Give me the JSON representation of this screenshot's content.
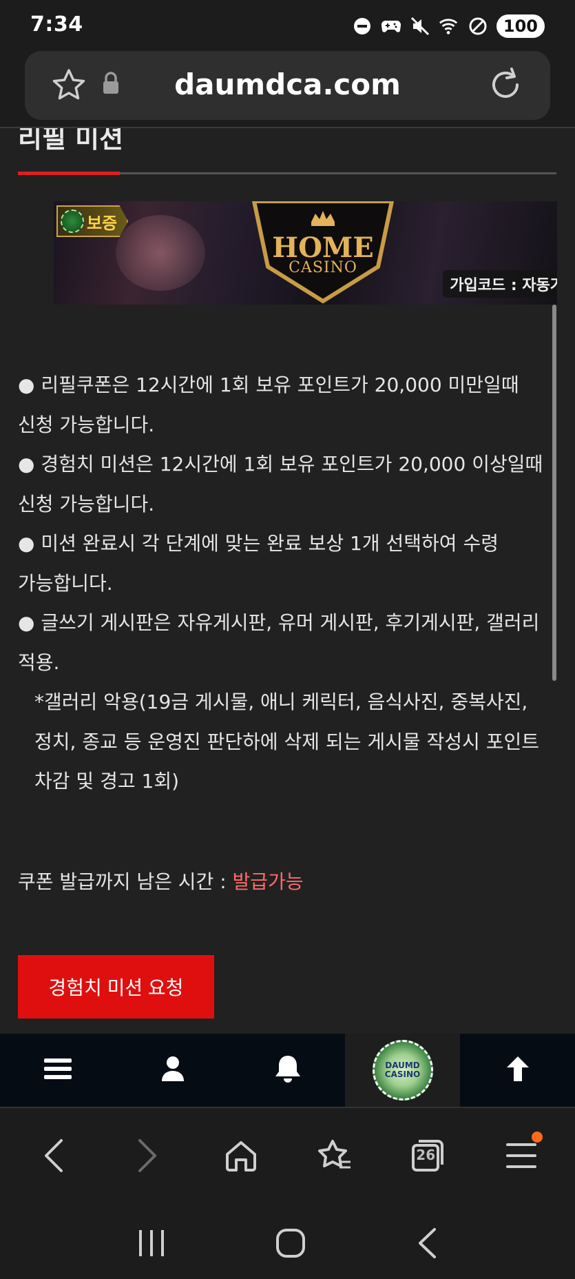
{
  "status_bar": {
    "time": "7:34",
    "battery": "100",
    "icons": [
      "do-not-disturb-icon",
      "game-controller-icon",
      "mute-icon",
      "wifi-icon",
      "blocked-icon"
    ]
  },
  "browser": {
    "url": "daumdca.com",
    "tab_count": "26",
    "icons": [
      "bookmark-star-icon",
      "lock-icon",
      "reload-icon",
      "back-icon",
      "forward-icon",
      "home-icon",
      "bookmarks-icon",
      "tabs-icon",
      "menu-icon"
    ]
  },
  "page": {
    "title": "리필 미션",
    "banner": {
      "badge": "보증",
      "brand_line1": "HOME",
      "brand_line2": "CASINO",
      "code_label": "가입코드 : 자동가"
    },
    "rules": [
      "● 리필쿠폰은 12시간에 1회 보유 포인트가 20,000 미만일때 신청 가능합니다.",
      "● 경험치 미션은 12시간에 1회 보유 포인트가 20,000 이상일때 신청 가능합니다.",
      "● 미션 완료시 각 단계에 맞는 완료 보상 1개 선택하여 수령 가능합니다.",
      "● 글쓰기 게시판은 자유게시판, 유머 게시판, 후기게시판, 갤러리 적용.",
      "*갤러리 악용(19금 게시물, 애니 케릭터, 음식사진, 중복사진, 정치, 종교 등 운영진 판단하에 삭제 되는 게시물 작성시 포인트 차감 및 경고 1회)"
    ],
    "coupon_label": "쿠폰 발급까지 남은 시간 : ",
    "coupon_status": "발급가능",
    "mission_button": "경험치 미션 요청"
  },
  "site_nav": {
    "items": [
      "menu-icon",
      "user-icon",
      "bell-icon",
      "daum-casino-logo",
      "arrow-up-icon"
    ],
    "logo_line1": "DAUMD",
    "logo_line2": "CASINO"
  },
  "colors": {
    "accent_red": "#e00f0f",
    "status_red": "#ff6b6b",
    "background": "#212121",
    "nav_background": "#050c14"
  }
}
